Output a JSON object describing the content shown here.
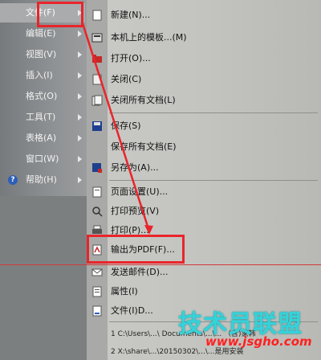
{
  "left_menu": {
    "items": [
      {
        "label": "文件(F)",
        "arrow": true
      },
      {
        "label": "编辑(E)",
        "arrow": true
      },
      {
        "label": "视图(V)",
        "arrow": true
      },
      {
        "label": "插入(I)",
        "arrow": true
      },
      {
        "label": "格式(O)",
        "arrow": true
      },
      {
        "label": "工具(T)",
        "arrow": true
      },
      {
        "label": "表格(A)",
        "arrow": true
      },
      {
        "label": "窗口(W)",
        "arrow": true
      },
      {
        "label": "帮助(H)",
        "arrow": true
      }
    ]
  },
  "file_menu": {
    "new": "新建(N)...",
    "templates": "本机上的模板...(M)",
    "open": "打开(O)...",
    "close": "关闭(C)",
    "close_all": "关闭所有文档(L)",
    "save": "保存(S)",
    "save_all": "保存所有文档(E)",
    "save_as": "另存为(A)...",
    "page_setup": "页面设置(U)...",
    "print_preview": "打印预览(V)",
    "print": "打印(P)...",
    "export_pdf": "输出为PDF(F)...",
    "send": "发送邮件(D)...",
    "properties": "属性(I)",
    "file_info": "文件(I)D...",
    "recent": [
      "1 C:\\Users\\...\\ Documents\\...\\... （含)家韩",
      "2 X:\\share\\...\\20150302\\...\\...是用安装"
    ]
  },
  "watermark": {
    "big": "技术员联盟",
    "small": "www.jsgho.com"
  },
  "colors": {
    "highlight": "#e8252b",
    "watermark_text": "#35d2d9"
  }
}
